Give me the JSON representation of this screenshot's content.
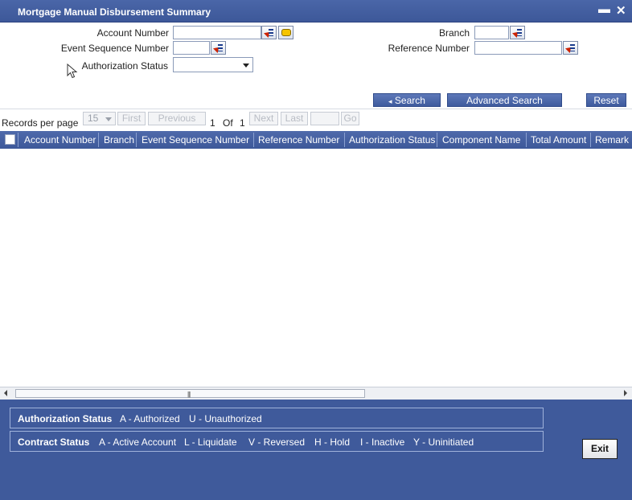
{
  "window": {
    "title": "Mortgage Manual Disbursement Summary",
    "minimize_glyph": "▬",
    "close_glyph": "✕"
  },
  "search_form": {
    "account_number_label": "Account Number",
    "event_sequence_number_label": "Event Sequence Number",
    "authorization_status_label": "Authorization Status",
    "branch_label": "Branch",
    "reference_number_label": "Reference Number",
    "account_number_value": "",
    "event_sequence_number_value": "",
    "authorization_status_value": "",
    "branch_value": "",
    "reference_number_value": ""
  },
  "actions": {
    "search_label": "Search",
    "advanced_search_label": "Advanced Search",
    "reset_label": "Reset"
  },
  "pagination": {
    "records_per_page_label": "Records per page",
    "records_per_page_value": "15",
    "first_label": "First",
    "previous_label": "Previous",
    "current_page": "1",
    "of_label": "Of",
    "total_pages": "1",
    "next_label": "Next",
    "last_label": "Last",
    "go_label": "Go"
  },
  "grid": {
    "columns": [
      "Account Number",
      "Branch",
      "Event Sequence Number",
      "Reference Number",
      "Authorization Status",
      "Component Name",
      "Total Amount",
      "Remark"
    ],
    "rows": []
  },
  "legend": {
    "authorization_status_title": "Authorization Status",
    "authorization_items": [
      "A - Authorized",
      "U - Unauthorized"
    ],
    "contract_status_title": "Contract Status",
    "contract_items": [
      "A - Active Account",
      "L - Liquidate",
      "V - Reversed",
      "H - Hold",
      "I - Inactive",
      "Y - Uninitiated"
    ]
  },
  "exit_label": "Exit",
  "colors": {
    "header_blue": "#3d5899",
    "footer_blue": "#3f5a9b"
  }
}
